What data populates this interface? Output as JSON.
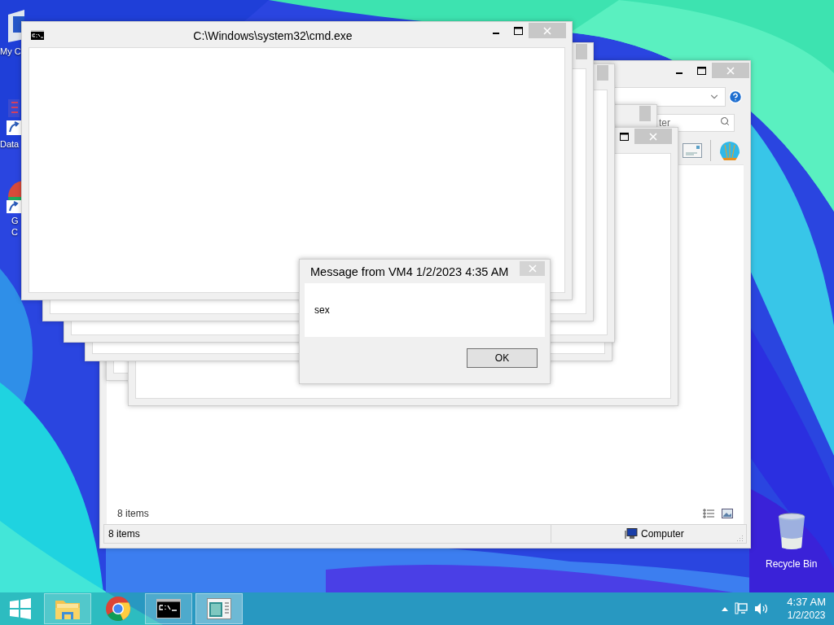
{
  "desktop_icons": [
    {
      "kind": "computer",
      "lines": [
        "My C"
      ]
    },
    {
      "kind": "shortcut",
      "lines": [
        "Data"
      ]
    },
    {
      "kind": "chrome",
      "lines": [
        "G",
        "C"
      ]
    }
  ],
  "recycle_bin": {
    "label": "Recycle Bin"
  },
  "explorer_window": {
    "search": {
      "placeholder": "ter"
    },
    "item_count": "8 items",
    "status_bar": {
      "items": "8 items",
      "location": "Computer"
    }
  },
  "cmd_window": {
    "title": "C:\\Windows\\system32\\cmd.exe"
  },
  "message_box": {
    "title": "Message from VM4 1/2/2023 4:35 AM",
    "message": "sex",
    "buttons": [
      "OK"
    ]
  },
  "taskbar": {
    "buttons": [
      {
        "kind": "explorer",
        "running": true,
        "selected": false
      },
      {
        "kind": "chrome",
        "running": false,
        "selected": false
      },
      {
        "kind": "cmd",
        "running": true,
        "selected": false
      },
      {
        "kind": "window",
        "running": true,
        "selected": true
      }
    ]
  },
  "clock": {
    "time": "4:37 AM",
    "date": "1/2/2023"
  }
}
